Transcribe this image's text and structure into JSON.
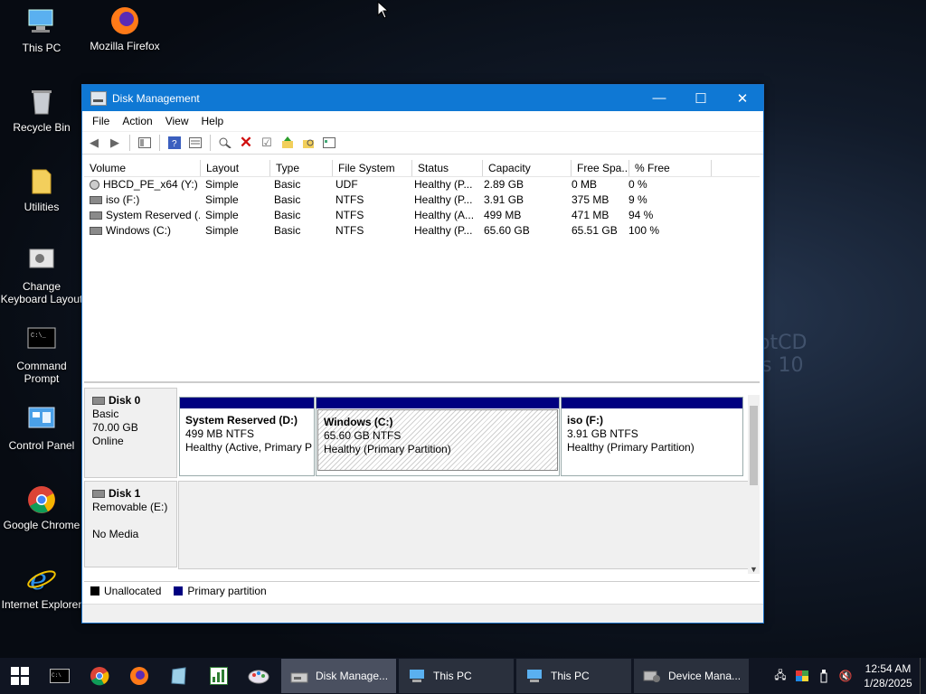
{
  "desktop": {
    "icons": [
      "This PC",
      "Mozilla Firefox",
      "Recycle Bin",
      "Utilities",
      "Change Keyboard Layout",
      "Command Prompt",
      "Control Panel",
      "Google Chrome",
      "Internet Explorer"
    ],
    "wallpaper_text": [
      "otCD",
      "s 10"
    ]
  },
  "window": {
    "title": "Disk Management",
    "controls": {
      "minimize": "—",
      "maximize": "☐",
      "close": "✕"
    }
  },
  "menu": [
    "File",
    "Action",
    "View",
    "Help"
  ],
  "volumes": {
    "columns": [
      "Volume",
      "Layout",
      "Type",
      "File System",
      "Status",
      "Capacity",
      "Free Spa...",
      "% Free"
    ],
    "rows": [
      [
        "HBCD_PE_x64 (Y:)",
        "Simple",
        "Basic",
        "UDF",
        "Healthy (P...",
        "2.89 GB",
        "0 MB",
        "0 %"
      ],
      [
        "iso (F:)",
        "Simple",
        "Basic",
        "NTFS",
        "Healthy (P...",
        "3.91 GB",
        "375 MB",
        "9 %"
      ],
      [
        "System Reserved (...",
        "Simple",
        "Basic",
        "NTFS",
        "Healthy (A...",
        "499 MB",
        "471 MB",
        "94 %"
      ],
      [
        "Windows (C:)",
        "Simple",
        "Basic",
        "NTFS",
        "Healthy (P...",
        "65.60 GB",
        "65.51 GB",
        "100 %"
      ]
    ]
  },
  "disks": {
    "disk0": {
      "name": "Disk 0",
      "kind": "Basic",
      "size": "70.00 GB",
      "state": "Online",
      "partitions": [
        {
          "name": "System Reserved  (D:)",
          "size": "499 MB NTFS",
          "status": "Healthy (Active, Primary P"
        },
        {
          "name": "Windows  (C:)",
          "size": "65.60 GB NTFS",
          "status": "Healthy (Primary Partition)"
        },
        {
          "name": "iso  (F:)",
          "size": "3.91 GB NTFS",
          "status": "Healthy (Primary Partition)"
        }
      ]
    },
    "disk1": {
      "name": "Disk 1",
      "kind": "Removable (E:)",
      "state": "No Media"
    }
  },
  "legend": {
    "unallocated": "Unallocated",
    "primary": "Primary partition"
  },
  "taskbar": {
    "apps": [
      "Disk Manage...",
      "This PC",
      "This PC",
      "Device Mana..."
    ],
    "time": "12:54 AM",
    "date": "1/28/2025"
  },
  "colors": {
    "primary_partition": "#000080",
    "unallocated": "#000000",
    "titlebar": "#0f78d4"
  }
}
